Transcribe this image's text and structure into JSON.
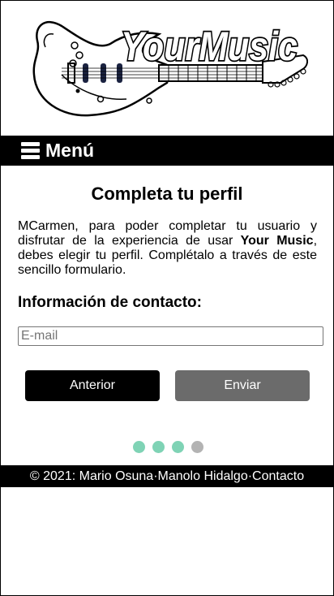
{
  "brand": {
    "logo_text": "YourMusic"
  },
  "nav": {
    "menu_label": "Menú"
  },
  "main": {
    "title": "Completa tu perfil",
    "intro_before": "MCarmen, para poder completar tu usuario y disfrutar de la experiencia de usar ",
    "intro_brand": "Your Music",
    "intro_after": ", debes elegir tu perfil. Complétalo a través de este sencillo formulario.",
    "section_title": "Información de contacto:",
    "email_placeholder": "E-mail",
    "email_value": ""
  },
  "buttons": {
    "previous": "Anterior",
    "send": "Enviar"
  },
  "progress": {
    "total_steps": 4,
    "completed_steps": 3,
    "completed_color": "#7fd3b5",
    "pending_color": "#b3b3b3"
  },
  "footer": {
    "copyright": "© 2021: Mario Osuna",
    "sep": " · ",
    "author2": "Manolo Hidalgo",
    "contact": "Contacto"
  },
  "colors": {
    "bar_background": "#000000",
    "disabled_button": "#6b6b6b"
  }
}
